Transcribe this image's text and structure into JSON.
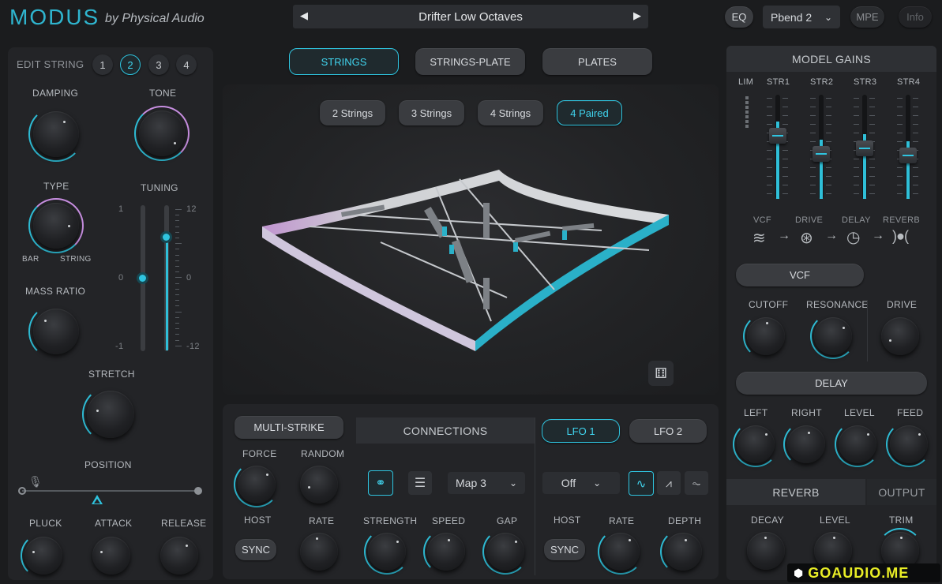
{
  "brand": {
    "logo": "MODUS",
    "by": "by Physical Audio"
  },
  "top": {
    "preset": "Drifter Low Octaves",
    "eq": "EQ",
    "pitchbend": "Pbend 2",
    "mpe": "MPE",
    "info": "Info"
  },
  "left": {
    "edit_string_label": "EDIT STRING",
    "strings": [
      "1",
      "2",
      "3",
      "4"
    ],
    "damping": "DAMPING",
    "tone": "TONE",
    "type": "TYPE",
    "tuning": "TUNING",
    "bar": "BAR",
    "string": "STRING",
    "mass_ratio": "MASS RATIO",
    "stretch": "STRETCH",
    "position": "POSITION",
    "tune_left": {
      "top": "1",
      "mid": "0",
      "bot": "-1"
    },
    "tune_right": {
      "top": "12",
      "mid": "0",
      "bot": "-12"
    },
    "pluck": "PLUCK",
    "attack": "ATTACK",
    "release": "RELEASE"
  },
  "model_tabs": [
    "STRINGS",
    "STRINGS-PLATE",
    "PLATES"
  ],
  "string_modes": [
    "2 Strings",
    "3 Strings",
    "4 Strings",
    "4 Paired"
  ],
  "bottom": {
    "multi_strike": "MULTI-STRIKE",
    "force": "FORCE",
    "random": "RANDOM",
    "host": "HOST",
    "rate": "RATE",
    "sync": "SYNC",
    "connections": "CONNECTIONS",
    "map": "Map 3",
    "strength": "STRENGTH",
    "speed": "SPEED",
    "gap": "GAP",
    "lfo1": "LFO 1",
    "lfo2": "LFO 2",
    "lfo_mode": "Off",
    "lfo_host": "HOST",
    "lfo_rate": "RATE",
    "depth": "DEPTH",
    "lfo_sync": "SYNC"
  },
  "right": {
    "model_gains": "MODEL GAINS",
    "lim": "LIM",
    "str": [
      "STR1",
      "STR2",
      "STR3",
      "STR4"
    ],
    "chain": [
      "VCF",
      "DRIVE",
      "DELAY",
      "REVERB"
    ],
    "vcf": "VCF",
    "cutoff": "CUTOFF",
    "resonance": "RESONANCE",
    "drive": "DRIVE",
    "delay": "DELAY",
    "left": "LEFT",
    "right_l": "RIGHT",
    "level": "LEVEL",
    "feed": "FEED",
    "reverb": "REVERB",
    "output": "OUTPUT",
    "decay": "DECAY",
    "rev_level": "LEVEL",
    "trim": "TRIM"
  },
  "watermark": "GOAUDIO.ME",
  "colors": {
    "accent": "#2fc4df",
    "purple": "#c78ee0",
    "bg": "#1b1c1e"
  }
}
